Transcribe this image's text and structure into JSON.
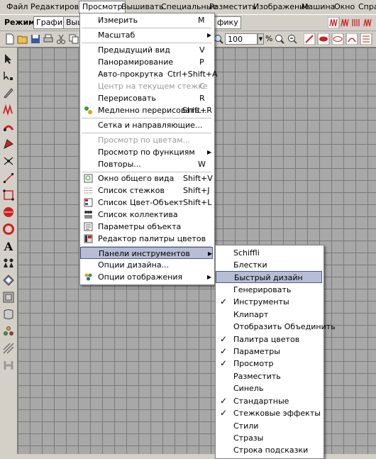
{
  "menubar": {
    "items": [
      "Файл",
      "Редактировать",
      "Просмотр",
      "Вышивать",
      "Специальные",
      "Разместить",
      "Изображение",
      "Машина",
      "Окно",
      "Справ"
    ]
  },
  "toolbar": {
    "mode_label": "Режим:",
    "mode_graphics": "Графика",
    "mode_embroidery": "Выш",
    "mode_tail": "фику",
    "zoom_value": "100",
    "zoom_unit": "%"
  },
  "view_menu": {
    "items": [
      {
        "label": "Измерить",
        "shortcut": "M"
      },
      {
        "label": "Масштаб",
        "submenu": true
      },
      {
        "label": "Предыдущий вид",
        "shortcut": "V"
      },
      {
        "label": "Панорамирование",
        "shortcut": "P"
      },
      {
        "label": "Авто-прокрутка",
        "shortcut": "Ctrl+Shift+A"
      },
      {
        "label": "Центр на текущем стежке",
        "shortcut": "C",
        "disabled": true
      },
      {
        "label": "Перерисовать",
        "shortcut": "R"
      },
      {
        "label": "Медленно перерисовать...",
        "shortcut": "Shift+R",
        "icon": "slow-redraw-icon"
      },
      {
        "label": "Сетка и направляющие..."
      },
      {
        "label": "Просмотр по цветам...",
        "disabled": true
      },
      {
        "label": "Просмотр по функциям",
        "submenu": true
      },
      {
        "label": "Повторы...",
        "shortcut": "W"
      },
      {
        "label": "Окно общего вида",
        "shortcut": "Shift+V",
        "icon": "overview-window-icon"
      },
      {
        "label": "Список стежков",
        "shortcut": "Shift+J",
        "icon": "stitch-list-icon"
      },
      {
        "label": "Список Цвет-Объект",
        "shortcut": "Shift+L",
        "icon": "color-object-list-icon"
      },
      {
        "label": "Список коллектива",
        "icon": "team-list-icon"
      },
      {
        "label": "Параметры объекта",
        "icon": "object-properties-icon"
      },
      {
        "label": "Редактор палитры цветов",
        "icon": "palette-editor-icon"
      },
      {
        "label": "Панели инструментов",
        "submenu": true,
        "highlighted": true
      },
      {
        "label": "Опции дизайна..."
      },
      {
        "label": "Опции отображения",
        "submenu": true,
        "icon": "display-options-icon"
      }
    ]
  },
  "toolbars_submenu": {
    "items": [
      {
        "label": "Schiffli",
        "checked": false
      },
      {
        "label": "Блестки",
        "checked": false
      },
      {
        "label": "Быстрый дизайн",
        "checked": false,
        "highlighted": true
      },
      {
        "label": "Генерировать",
        "checked": false
      },
      {
        "label": "Инструменты",
        "checked": true
      },
      {
        "label": "Клипарт",
        "checked": false
      },
      {
        "label": "Отобразить Объединить",
        "checked": false
      },
      {
        "label": "Палитра цветов",
        "checked": true
      },
      {
        "label": "Параметры",
        "checked": true
      },
      {
        "label": "Просмотр",
        "checked": true
      },
      {
        "label": "Разместить",
        "checked": false
      },
      {
        "label": "Синель",
        "checked": false
      },
      {
        "label": "Стандартные",
        "checked": true
      },
      {
        "label": "Стежковые эффекты",
        "checked": true
      },
      {
        "label": "Стили",
        "checked": false
      },
      {
        "label": "Стразы",
        "checked": false
      },
      {
        "label": "Строка подсказки",
        "checked": false
      }
    ]
  },
  "left_tools": [
    "pointer-tool-icon",
    "reshape-tool-icon",
    "knife-tool-icon",
    "running-stitch-icon",
    "satin-tool-icon",
    "fill-tool-icon",
    "line-tool-icon",
    "polyline-tool-icon",
    "shape-tool-icon",
    "circle-tool-icon",
    "applique-tool-icon",
    "text-tool-icon",
    "team-names-icon",
    "monogram-icon",
    "frame-tool-icon",
    "border-tool-icon",
    "sequin-tool-icon",
    "hatch-tool-icon",
    "h-tool-icon"
  ],
  "colors": {
    "menu_highlight": "#b7bdd4",
    "canvas_bg": "#a8a8a8",
    "grid_line": "#7a7a7a",
    "chrome": "#d4d0c8",
    "accent_red": "#cc2222"
  }
}
